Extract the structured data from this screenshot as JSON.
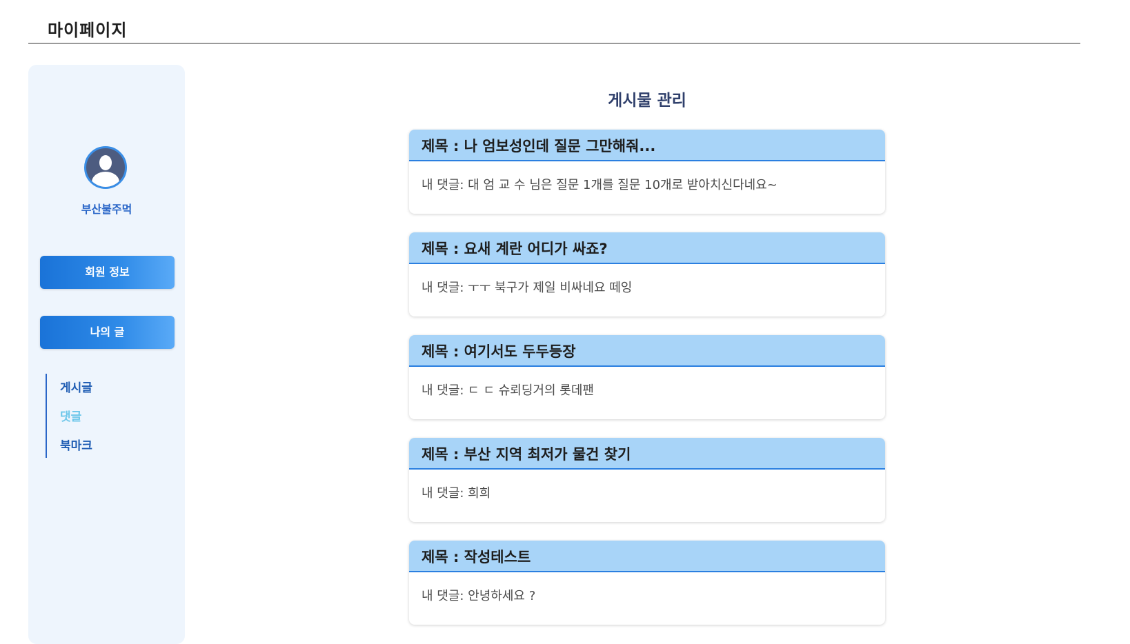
{
  "header": {
    "title": "마이페이지"
  },
  "sidebar": {
    "username": "부산불주먹",
    "buttons": {
      "member_info": "회원 정보",
      "my_posts": "나의 글"
    },
    "sub_items": [
      {
        "label": "게시글",
        "active": false
      },
      {
        "label": "댓글",
        "active": true
      },
      {
        "label": "북마크",
        "active": false
      }
    ]
  },
  "main": {
    "section_title": "게시물 관리",
    "posts": [
      {
        "title": "제목 : 나 엄보성인데 질문 그만해줘...",
        "comment": "내 댓글: 대 엄 교 수 님은 질문 1개를 질문 10개로 받아치신다네요~"
      },
      {
        "title": "제목 : 요새 계란 어디가 싸죠?",
        "comment": "내 댓글: ㅜㅜ 북구가 제일 비싸네요 떼잉"
      },
      {
        "title": "제목 : 여기서도 두두등장",
        "comment": "내 댓글: ㄷ ㄷ 슈뢰딩거의 롯데팬"
      },
      {
        "title": "제목 : 부산 지역 최저가 물건 찾기",
        "comment": "내 댓글: 희희"
      },
      {
        "title": "제목 : 작성테스트",
        "comment": "내 댓글: 안녕하세요 ?"
      }
    ]
  },
  "colors": {
    "accent": "#1a73d8",
    "card_header": "#a8d4f8",
    "active_sub_item": "#6ec7ea",
    "sidebar_bg": "#eef5fd"
  }
}
